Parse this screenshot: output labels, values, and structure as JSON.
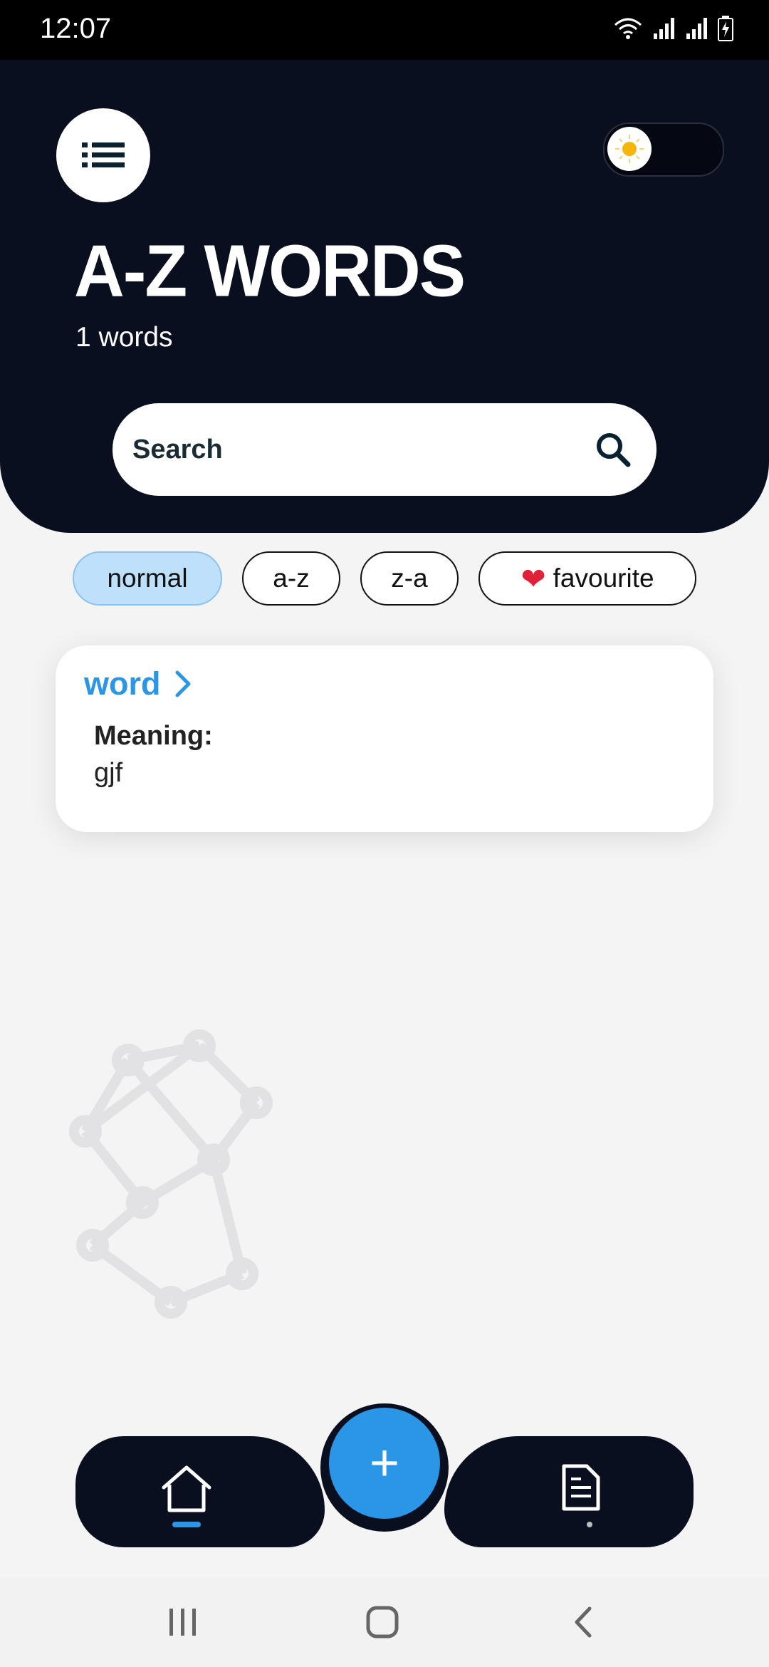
{
  "status_bar": {
    "time": "12:07",
    "icons": [
      "wifi-icon",
      "signal-icon",
      "signal-icon",
      "battery-charging-icon"
    ]
  },
  "header": {
    "menu_icon": "list-icon",
    "theme_toggle_icon": "sun-icon",
    "title": "A-Z WORDS",
    "word_count": "1 words",
    "search_placeholder": "Search",
    "search_value": ""
  },
  "filters": [
    {
      "label": "normal",
      "active": true
    },
    {
      "label": "a-z",
      "active": false
    },
    {
      "label": "z-a",
      "active": false
    },
    {
      "label": "favourite",
      "icon": "heart-icon",
      "active": false
    }
  ],
  "word_card": {
    "word": "word",
    "meaning_label": "Meaning:",
    "meaning_value": "gjf"
  },
  "bottom_nav": {
    "home_icon": "home-icon",
    "add_symbol": "+",
    "notes_icon": "document-icon"
  },
  "colors": {
    "header_bg": "#0a0f1f",
    "accent": "#2b96e6",
    "chip_active_bg": "#bfe0fb",
    "heart": "#e0213a"
  }
}
